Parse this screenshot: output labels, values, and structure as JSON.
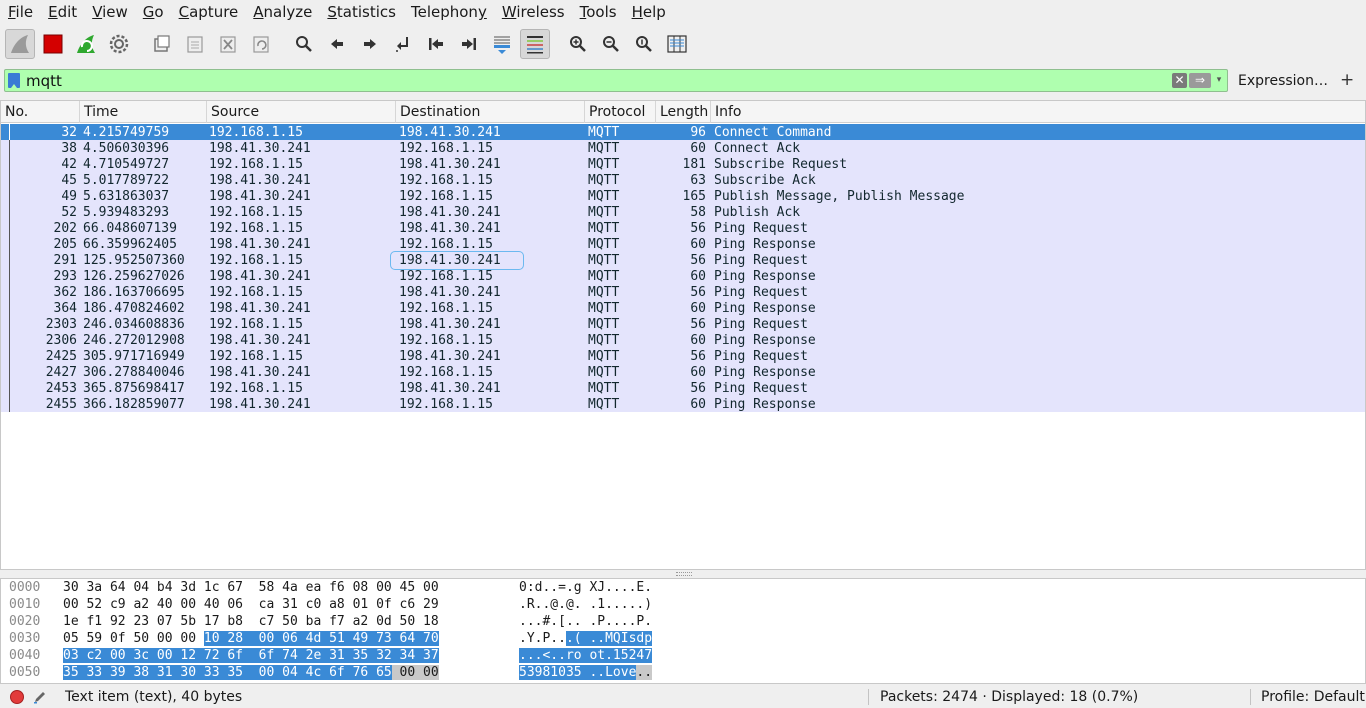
{
  "menu": [
    {
      "key": "file",
      "u": "F",
      "rest": "ile"
    },
    {
      "key": "edit",
      "u": "E",
      "rest": "dit"
    },
    {
      "key": "view",
      "u": "V",
      "rest": "iew"
    },
    {
      "key": "go",
      "u": "G",
      "rest": "o"
    },
    {
      "key": "capture",
      "u": "C",
      "rest": "apture"
    },
    {
      "key": "analyze",
      "u": "A",
      "rest": "nalyze"
    },
    {
      "key": "statistics",
      "u": "S",
      "rest": "tatistics"
    },
    {
      "key": "telephony",
      "u": "",
      "rest": "Telephon",
      "u2": "y"
    },
    {
      "key": "wireless",
      "u": "W",
      "rest": "ireless"
    },
    {
      "key": "tools",
      "u": "T",
      "rest": "ools"
    },
    {
      "key": "help",
      "u": "H",
      "rest": "elp"
    }
  ],
  "filter": {
    "value": "mqtt",
    "expression_label": "Expression…",
    "plus_label": "+",
    "clear_glyph": "✕",
    "apply_glyph": "⇒",
    "drop_glyph": "▾"
  },
  "columns": {
    "no": "No.",
    "time": "Time",
    "source": "Source",
    "destination": "Destination",
    "protocol": "Protocol",
    "length": "Length",
    "info": "Info"
  },
  "packets": [
    {
      "no": "32",
      "time": "4.215749759",
      "src": "192.168.1.15",
      "dst": "198.41.30.241",
      "proto": "MQTT",
      "len": "96",
      "info": "Connect Command",
      "selected": true
    },
    {
      "no": "38",
      "time": "4.506030396",
      "src": "198.41.30.241",
      "dst": "192.168.1.15",
      "proto": "MQTT",
      "len": "60",
      "info": "Connect Ack"
    },
    {
      "no": "42",
      "time": "4.710549727",
      "src": "192.168.1.15",
      "dst": "198.41.30.241",
      "proto": "MQTT",
      "len": "181",
      "info": "Subscribe Request"
    },
    {
      "no": "45",
      "time": "5.017789722",
      "src": "198.41.30.241",
      "dst": "192.168.1.15",
      "proto": "MQTT",
      "len": "63",
      "info": "Subscribe Ack"
    },
    {
      "no": "49",
      "time": "5.631863037",
      "src": "198.41.30.241",
      "dst": "192.168.1.15",
      "proto": "MQTT",
      "len": "165",
      "info": "Publish Message, Publish Message"
    },
    {
      "no": "52",
      "time": "5.939483293",
      "src": "192.168.1.15",
      "dst": "198.41.30.241",
      "proto": "MQTT",
      "len": "58",
      "info": "Publish Ack"
    },
    {
      "no": "202",
      "time": "66.048607139",
      "src": "192.168.1.15",
      "dst": "198.41.30.241",
      "proto": "MQTT",
      "len": "56",
      "info": "Ping Request"
    },
    {
      "no": "205",
      "time": "66.359962405",
      "src": "198.41.30.241",
      "dst": "192.168.1.15",
      "proto": "MQTT",
      "len": "60",
      "info": "Ping Response"
    },
    {
      "no": "291",
      "time": "125.952507360",
      "src": "192.168.1.15",
      "dst": "198.41.30.241",
      "proto": "MQTT",
      "len": "56",
      "info": "Ping Request"
    },
    {
      "no": "293",
      "time": "126.259627026",
      "src": "198.41.30.241",
      "dst": "192.168.1.15",
      "proto": "MQTT",
      "len": "60",
      "info": "Ping Response"
    },
    {
      "no": "362",
      "time": "186.163706695",
      "src": "192.168.1.15",
      "dst": "198.41.30.241",
      "proto": "MQTT",
      "len": "56",
      "info": "Ping Request"
    },
    {
      "no": "364",
      "time": "186.470824602",
      "src": "198.41.30.241",
      "dst": "192.168.1.15",
      "proto": "MQTT",
      "len": "60",
      "info": "Ping Response"
    },
    {
      "no": "2303",
      "time": "246.034608836",
      "src": "192.168.1.15",
      "dst": "198.41.30.241",
      "proto": "MQTT",
      "len": "56",
      "info": "Ping Request"
    },
    {
      "no": "2306",
      "time": "246.272012908",
      "src": "198.41.30.241",
      "dst": "192.168.1.15",
      "proto": "MQTT",
      "len": "60",
      "info": "Ping Response"
    },
    {
      "no": "2425",
      "time": "305.971716949",
      "src": "192.168.1.15",
      "dst": "198.41.30.241",
      "proto": "MQTT",
      "len": "56",
      "info": "Ping Request"
    },
    {
      "no": "2427",
      "time": "306.278840046",
      "src": "198.41.30.241",
      "dst": "192.168.1.15",
      "proto": "MQTT",
      "len": "60",
      "info": "Ping Response"
    },
    {
      "no": "2453",
      "time": "365.875698417",
      "src": "192.168.1.15",
      "dst": "198.41.30.241",
      "proto": "MQTT",
      "len": "56",
      "info": "Ping Request"
    },
    {
      "no": "2455",
      "time": "366.182859077",
      "src": "198.41.30.241",
      "dst": "192.168.1.15",
      "proto": "MQTT",
      "len": "60",
      "info": "Ping Response"
    }
  ],
  "hex": [
    {
      "offset": "0000",
      "bytes": [
        [
          "30 3a 64 04 b4 3d 1c 67  58 4a ea f6 08 00 45 00",
          ""
        ]
      ],
      "ascii": [
        [
          "0:d..=.g XJ....E.",
          ""
        ]
      ]
    },
    {
      "offset": "0010",
      "bytes": [
        [
          "00 52 c9 a2 40 00 40 06  ca 31 c0 a8 01 0f c6 29",
          ""
        ]
      ],
      "ascii": [
        [
          ".R..@.@. .1.....)",
          ""
        ]
      ]
    },
    {
      "offset": "0020",
      "bytes": [
        [
          "1e f1 92 23 07 5b 17 b8  c7 50 ba f7 a2 0d 50 18",
          ""
        ]
      ],
      "ascii": [
        [
          "...#.[.. .P....P.",
          ""
        ]
      ]
    },
    {
      "offset": "0030",
      "bytes": [
        [
          "05 59 0f 50 00 00 ",
          ""
        ],
        [
          "10 28  00 06 4d 51 49 73 64 70",
          "hl"
        ]
      ],
      "ascii": [
        [
          ".Y.P..",
          ""
        ],
        [
          ".( ..MQIsdp",
          "hl"
        ]
      ]
    },
    {
      "offset": "0040",
      "bytes": [
        [
          "03 c2 00 3c 00 12 72 6f  6f 74 2e 31 35 32 34 37",
          "hl"
        ]
      ],
      "ascii": [
        [
          "...<..ro ot.15247",
          "hl"
        ]
      ]
    },
    {
      "offset": "0050",
      "bytes": [
        [
          "35 33 39 38 31 30 33 35  00 04 4c 6f 76 65",
          "hl"
        ],
        [
          " 00 00",
          "hl2"
        ]
      ],
      "ascii": [
        [
          "53981035 ..Love",
          "hl"
        ],
        [
          "..",
          "hl2"
        ]
      ]
    }
  ],
  "status": {
    "item_text": "Text item (text), 40 bytes",
    "packets_text": "Packets: 2474 · Displayed: 18 (0.7%)",
    "profile_text": "Profile: Default"
  },
  "colors": {
    "filter_valid": "#afffaf",
    "row_mqtt": "#e4e4fc",
    "row_selected": "#3a8ad6",
    "stop_button": "#d40000",
    "restart_button": "#2fa82f"
  }
}
